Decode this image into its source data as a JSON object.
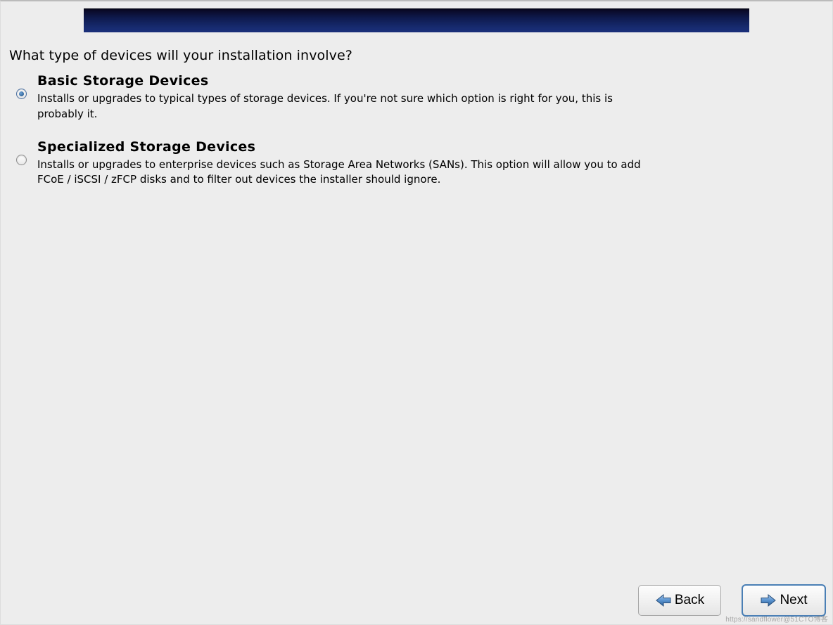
{
  "header": {
    "question": "What type of devices will your installation involve?"
  },
  "options": [
    {
      "title": "Basic Storage Devices",
      "description": "Installs or upgrades to typical types of storage devices.  If you're not sure which option is right for you, this is probably it.",
      "selected": true
    },
    {
      "title": "Specialized Storage Devices",
      "description": "Installs or upgrades to enterprise devices such as Storage Area Networks (SANs). This option will allow you to add FCoE / iSCSI / zFCP disks and to filter out devices the installer should ignore.",
      "selected": false
    }
  ],
  "footer": {
    "back_label": "Back",
    "next_label": "Next"
  },
  "watermark": "https://sandflower@51CTO博客"
}
